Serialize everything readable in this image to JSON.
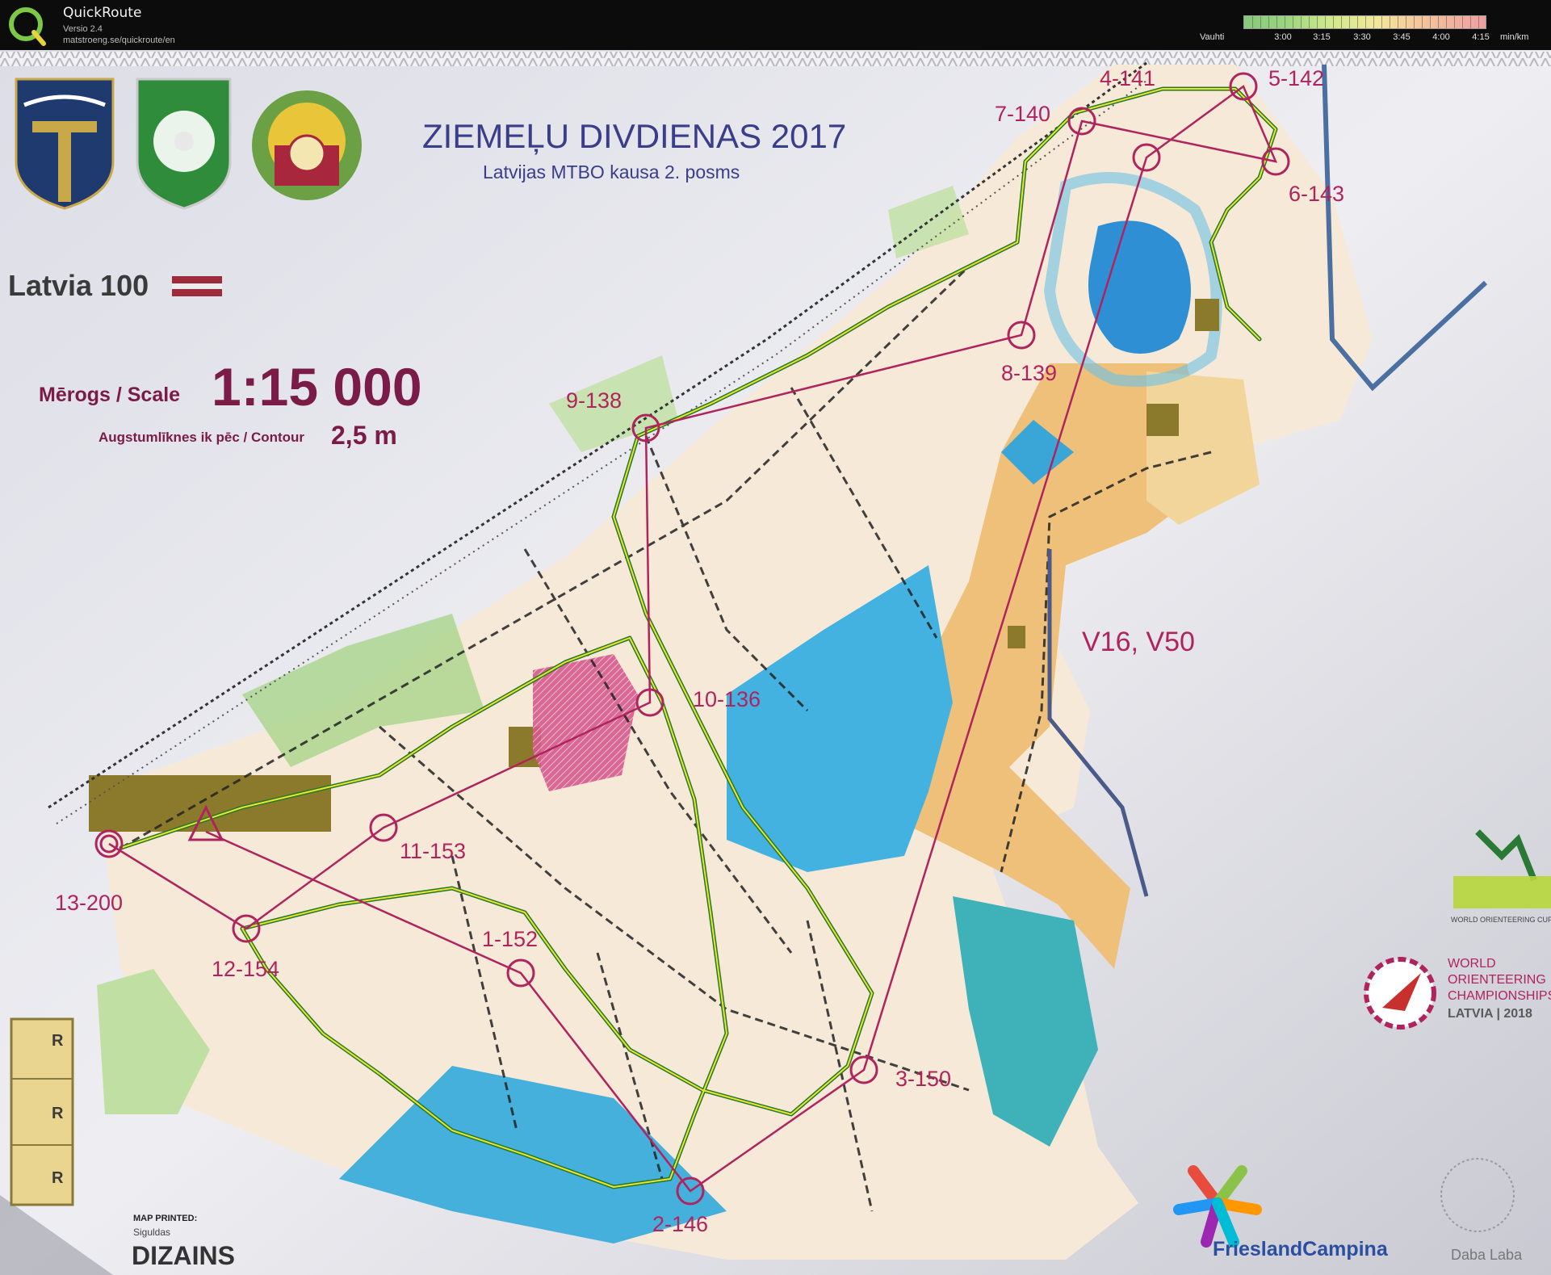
{
  "window": {
    "app_name": "QuickRoute",
    "version": "Versio 2.4",
    "url": "matstroeng.se/quickroute/en"
  },
  "pace_scale": {
    "label": "Vauhti",
    "ticks": [
      "3:00",
      "3:15",
      "3:30",
      "3:45",
      "4:00",
      "4:15"
    ],
    "unit": "min/km"
  },
  "map": {
    "event_title": "ZIEMEĻU DIVDIENAS 2017",
    "event_subtitle": "Latvijas MTBO kausa 2. posms",
    "centenary_logo": "Latvia 100",
    "scale_label": "Mērogs / Scale",
    "scale_value": "1:15 000",
    "contour_label": "Augstumlīknes ik pēc / Contour",
    "contour_value": "2,5 m",
    "course_classes": "V16, V50",
    "controls": [
      "1-152",
      "2-146",
      "3-150",
      "4-141",
      "5-142",
      "6-143",
      "7-140",
      "8-139",
      "9-138",
      "10-136",
      "11-153",
      "12-154",
      "13-200"
    ],
    "map_printed_label": "MAP PRINTED:",
    "printer_name": "Siguldas",
    "printer_brand": "DIZAINS",
    "wcup_label": "WORLD ORIENTEERING CUP | LATVIA",
    "woc_title": [
      "WORLD",
      "ORIENTEERING",
      "CHAMPIONSHIPS",
      "LATVIA | 2018"
    ],
    "sponsor": "FrieslandCampina",
    "sponsor2": "Daba Laba",
    "side_letters": [
      "R",
      "R",
      "R"
    ]
  },
  "colors": {
    "course_magenta": "#b0245e",
    "route_green": "#1f7a2a",
    "route_yellow": "#f0e030",
    "water_blue": "#3aa6d8",
    "open_land": "#f0c070"
  }
}
